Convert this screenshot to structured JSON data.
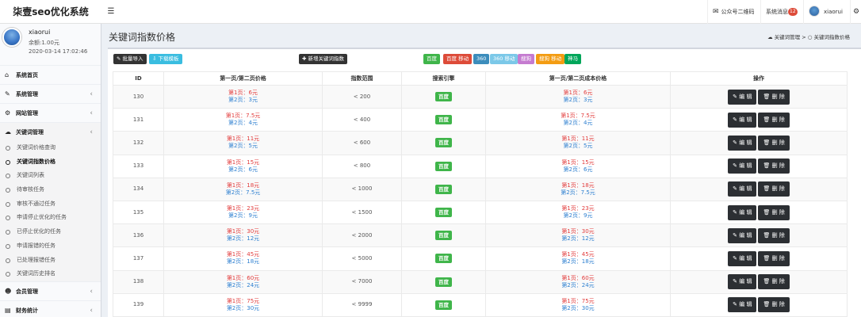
{
  "app": {
    "title": "柒壹seo优化系统"
  },
  "topbar": {
    "menu_icon": "☰",
    "qrcode_label": "公众号二维码",
    "messages_label": "系统消息",
    "messages_count": "12",
    "user_label": "xiaorui",
    "settings_icon": "⚙"
  },
  "user_panel": {
    "name": "xiaorui",
    "balance": "余额:1.00元",
    "time": "2020-03-14 17:02:46"
  },
  "sidebar": {
    "items_top": [
      {
        "icon": "⌂",
        "label": "系统首页"
      },
      {
        "icon": "✎",
        "label": "系统管理",
        "chevron": "‹"
      },
      {
        "icon": "⚙",
        "label": "网站管理",
        "chevron": "‹"
      },
      {
        "icon": "☁",
        "label": "关键词管理",
        "chevron": "‹"
      }
    ],
    "sub_items": [
      {
        "label": "关键词价格查询"
      },
      {
        "label": "关键词指数价格"
      },
      {
        "label": "关键词列表"
      },
      {
        "label": "待审核任务"
      },
      {
        "label": "审核不通过任务"
      },
      {
        "label": "申请停止优化的任务"
      },
      {
        "label": "已停止优化的任务"
      },
      {
        "label": "申请报错的任务"
      },
      {
        "label": "已处理报错任务"
      },
      {
        "label": "关键词历史排名"
      }
    ],
    "items_bottom": [
      {
        "icon": "☻",
        "label": "会员管理",
        "chevron": "‹"
      },
      {
        "icon": "▤",
        "label": "财务统计",
        "chevron": "‹"
      }
    ]
  },
  "content_header": {
    "title": "关键词指数价格",
    "breadcrumb_parent": "关键词管理",
    "breadcrumb_sep": ">",
    "breadcrumb_current": "关键词指数价格"
  },
  "toolbar": {
    "import_label": "批量导入",
    "template_label": "下载模板",
    "add_label": "新增关键词指数"
  },
  "engines": [
    {
      "label": "百度",
      "color": "#3fb54a"
    },
    {
      "label": "百度 移动",
      "color": "#dd4b39"
    },
    {
      "label": "360",
      "color": "#3c8dbc"
    },
    {
      "label": "360 移动",
      "color": "#7bc8e8"
    },
    {
      "label": "搜狗",
      "color": "#c57bd0"
    },
    {
      "label": "搜狗 移动",
      "color": "#f39c12"
    },
    {
      "label": "神马",
      "color": "#00a65a"
    }
  ],
  "table": {
    "headers": [
      "ID",
      "第一页/第二页价格",
      "指数范围",
      "搜索引擎",
      "第一页/第二页成本价格",
      "操作"
    ],
    "edit_label": "编 辑",
    "delete_label": "删 除",
    "rows": [
      {
        "id": "130",
        "p1": "第1页：6元",
        "p2": "第2页：3元",
        "range": "< 200",
        "engine": "百度",
        "c1": "第1页：6元",
        "c2": "第2页：3元"
      },
      {
        "id": "131",
        "p1": "第1页：7.5元",
        "p2": "第2页：4元",
        "range": "< 400",
        "engine": "百度",
        "c1": "第1页：7.5元",
        "c2": "第2页：4元"
      },
      {
        "id": "132",
        "p1": "第1页：11元",
        "p2": "第2页：5元",
        "range": "< 600",
        "engine": "百度",
        "c1": "第1页：11元",
        "c2": "第2页：5元"
      },
      {
        "id": "133",
        "p1": "第1页：15元",
        "p2": "第2页：6元",
        "range": "< 800",
        "engine": "百度",
        "c1": "第1页：15元",
        "c2": "第2页：6元"
      },
      {
        "id": "134",
        "p1": "第1页：18元",
        "p2": "第2页：7.5元",
        "range": "< 1000",
        "engine": "百度",
        "c1": "第1页：18元",
        "c2": "第2页：7.5元"
      },
      {
        "id": "135",
        "p1": "第1页：23元",
        "p2": "第2页：9元",
        "range": "< 1500",
        "engine": "百度",
        "c1": "第1页：23元",
        "c2": "第2页：9元"
      },
      {
        "id": "136",
        "p1": "第1页：30元",
        "p2": "第2页：12元",
        "range": "< 2000",
        "engine": "百度",
        "c1": "第1页：30元",
        "c2": "第2页：12元"
      },
      {
        "id": "137",
        "p1": "第1页：45元",
        "p2": "第2页：18元",
        "range": "< 5000",
        "engine": "百度",
        "c1": "第1页：45元",
        "c2": "第2页：18元"
      },
      {
        "id": "138",
        "p1": "第1页：60元",
        "p2": "第2页：24元",
        "range": "< 7000",
        "engine": "百度",
        "c1": "第1页：60元",
        "c2": "第2页：24元"
      },
      {
        "id": "139",
        "p1": "第1页：75元",
        "p2": "第2页：30元",
        "range": "< 9999",
        "engine": "百度",
        "c1": "第1页：75元",
        "c2": "第2页：30元"
      }
    ]
  }
}
